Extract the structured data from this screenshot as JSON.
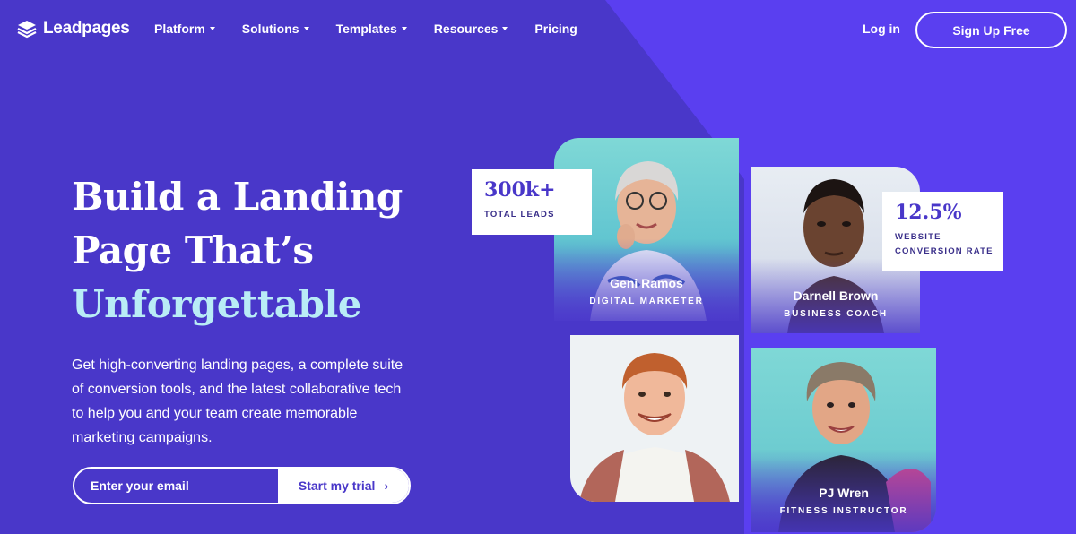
{
  "nav": {
    "logo_text": "Leadpages",
    "links": [
      {
        "label": "Platform"
      },
      {
        "label": "Solutions"
      },
      {
        "label": "Templates"
      },
      {
        "label": "Resources"
      },
      {
        "label": "Pricing"
      }
    ],
    "login_label": "Log in",
    "signup_label": "Sign Up Free"
  },
  "hero": {
    "headline_line1": "Build a Landing",
    "headline_line2": "Page That’s",
    "headline_highlight": "Unforgettable",
    "subtext": "Get high-converting landing pages, a complete suite of conversion tools, and the latest collaborative tech to help you and your team create memorable marketing campaigns.",
    "email_placeholder": "Enter your email",
    "trial_label": "Start my trial"
  },
  "stats": [
    {
      "value": "300k+",
      "label": "TOTAL LEADS"
    },
    {
      "value": "12.5%",
      "label_line1": "WEBSITE",
      "label_line2": "CONVERSION RATE"
    }
  ],
  "profiles": [
    {
      "name": "Geni Ramos",
      "role": "DIGITAL MARKETER"
    },
    {
      "name": "Darnell Brown",
      "role": "BUSINESS COACH"
    },
    {
      "name": "",
      "role": ""
    },
    {
      "name": "PJ Wren",
      "role": "FITNESS INSTRUCTOR"
    }
  ],
  "colors": {
    "background": "#4937c9",
    "accent_shape": "#5a3ff0",
    "highlight_text": "#b9ecf6",
    "card_teal": "#7fd8d6"
  }
}
